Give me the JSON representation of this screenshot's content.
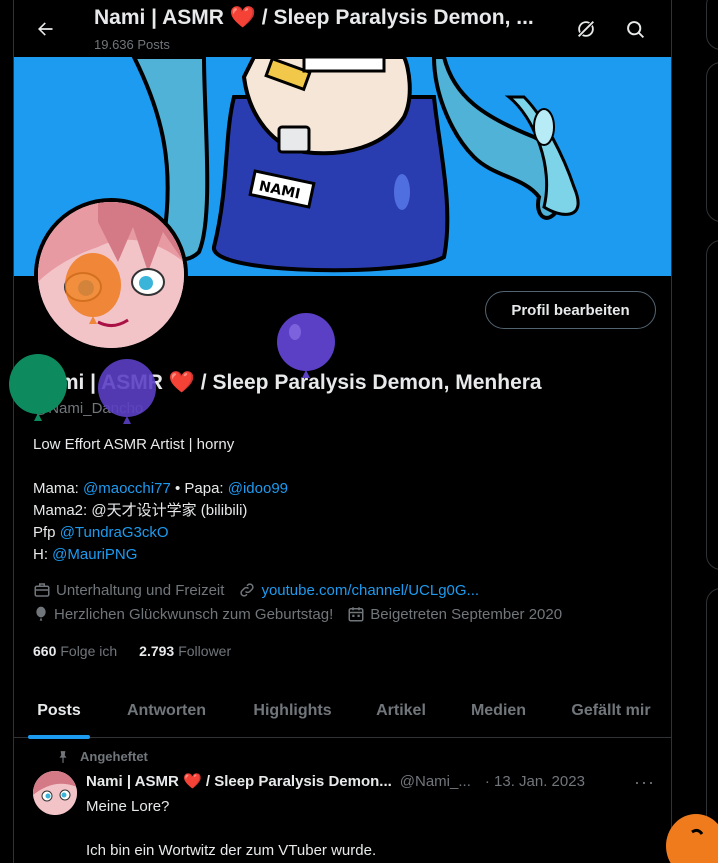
{
  "header": {
    "title_prefix": "Nami | ASMR",
    "heart": "❤️",
    "title_suffix": "/ Sleep Paralysis Demon, ...",
    "post_count": "19.636 Posts",
    "back_icon": "arrow-left-icon",
    "grok_icon": "grok-icon",
    "search_icon": "search-icon"
  },
  "profile": {
    "edit_button": "Profil bearbeiten",
    "name_prefix": "Nami | ASMR",
    "heart": "❤️",
    "name_suffix": "/ Sleep Paralysis Demon, Menhera",
    "handle": "@Nami_Dancho",
    "bio": {
      "line1": "Low Effort ASMR Artist | horny",
      "mama_label": "Mama: ",
      "mama_link": "@maocchi77",
      "sep": " • Papa: ",
      "papa_link": "@idoo99",
      "mama2": "Mama2: @天才设计学家 (bilibili)",
      "pfp_label": "Pfp ",
      "pfp_link": "@TundraG3ckO",
      "h_label": "H: ",
      "h_link": "@MauriPNG"
    },
    "category": "Unterhaltung und Freizeit",
    "website": "youtube.com/channel/UCLg0G...",
    "birthday": "Herzlichen Glückwunsch zum Geburtstag!",
    "joined": "Beigetreten September 2020",
    "following_count": "660",
    "following_label": "Folge ich",
    "followers_count": "2.793",
    "followers_label": "Follower"
  },
  "tabs": [
    {
      "label": "Posts"
    },
    {
      "label": "Antworten"
    },
    {
      "label": "Highlights"
    },
    {
      "label": "Artikel"
    },
    {
      "label": "Medien"
    },
    {
      "label": "Gefällt mir"
    }
  ],
  "pinned_tweet": {
    "pinned_label": "Angeheftet",
    "name_prefix": "Nami | ASMR",
    "heart": "❤️",
    "name_suffix": "/ Sleep Paralysis Demon...",
    "handle": "@Nami_...",
    "date": "· 13. Jan. 2023",
    "more": "···",
    "text": "Meine Lore?\n\nIch bin ein Wortwitz der zum VTuber wurde."
  },
  "colors": {
    "accent": "#1d9bf0",
    "heart": "#f91880",
    "muted": "#71767b",
    "balloon_green": "#0e8a5f",
    "balloon_purple": "#5b3fc4",
    "balloon_orange": "#f07b1d"
  }
}
